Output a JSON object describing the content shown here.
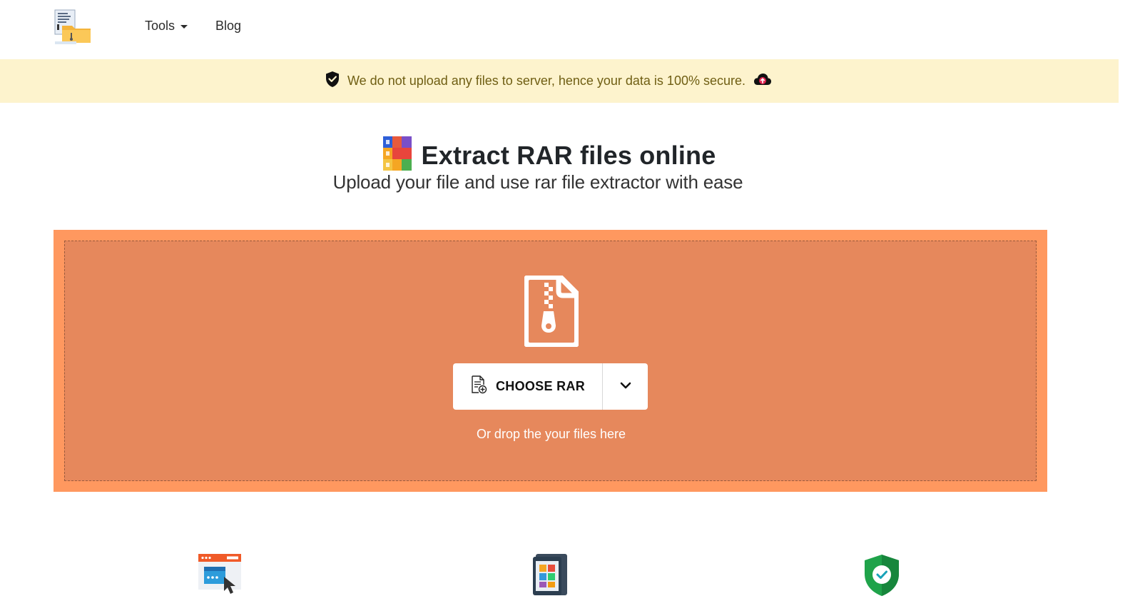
{
  "nav": {
    "logo_icon": "archive-folder-logo-icon",
    "tools_label": "Tools",
    "blog_label": "Blog"
  },
  "banner": {
    "text": "We do not upload any files to server, hence your data is 100% secure.",
    "left_icon": "shield-icon",
    "right_icon": "cloud-no-upload-icon"
  },
  "hero": {
    "title": "Extract RAR files online",
    "subtitle": "Upload your file and use rar file extractor with ease",
    "title_icon": "rar-archive-icon"
  },
  "dropzone": {
    "icon": "zip-file-icon",
    "choose_label": "CHOOSE RAR",
    "hint": "Or drop the your files here",
    "colors": {
      "outer": "#ff985f",
      "inner": "#e6885c"
    }
  },
  "features": [
    {
      "icon": "browser-click-icon"
    },
    {
      "icon": "mobile-apps-icon"
    },
    {
      "icon": "security-shield-check-icon"
    }
  ]
}
